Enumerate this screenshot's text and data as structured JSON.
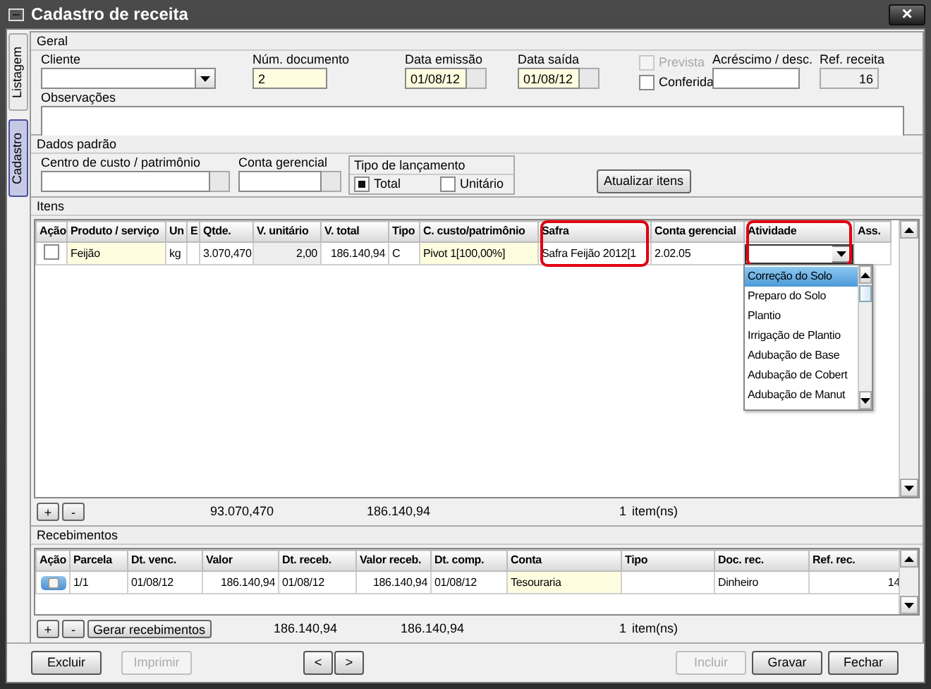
{
  "window": {
    "title": "Cadastro de receita",
    "close_glyph": "×"
  },
  "side_tabs": [
    {
      "label": "Listagem",
      "selected": false
    },
    {
      "label": "Cadastro",
      "selected": true
    }
  ],
  "geral": {
    "title": "Geral",
    "fields": [
      {
        "kind": "combo",
        "label": "Cliente"
      },
      {
        "kind": "text",
        "label": "Núm. documento",
        "value": "2",
        "required": true
      },
      {
        "kind": "date",
        "label": "Data emissão",
        "value": "01/08/12",
        "required": true
      },
      {
        "kind": "date",
        "label": "Data saída",
        "value": "01/08/12",
        "required": true
      },
      {
        "kind": "checks",
        "options": [
          {
            "label": "Prevista",
            "checked": false,
            "disabled": true
          },
          {
            "label": "Conferida",
            "checked": false,
            "disabled": false
          }
        ]
      },
      {
        "kind": "text",
        "label": "Acréscimo / desc.",
        "required": false
      },
      {
        "kind": "readonly",
        "label": "Ref. receita",
        "value": "16"
      }
    ],
    "notes": {
      "label": "Observações"
    }
  },
  "dados_padrao": {
    "title": "Dados padrão",
    "fields": [
      {
        "kind": "lookup",
        "label": "Centro de custo / patrimônio"
      },
      {
        "kind": "lookup",
        "label": "Conta gerencial"
      }
    ],
    "tipo_lancamento": {
      "label": "Tipo de lançamento",
      "options": [
        {
          "label": "Total",
          "selected": true
        },
        {
          "label": "Unitário",
          "selected": false
        }
      ]
    },
    "button": "Atualizar itens"
  },
  "itens": {
    "title": "Itens",
    "columns": [
      {
        "label": "Ação",
        "highlighted": false
      },
      {
        "label": "Produto / serviço",
        "highlighted": false
      },
      {
        "label": "Un",
        "highlighted": false
      },
      {
        "label": "E",
        "highlighted": false
      },
      {
        "label": "Qtde.",
        "highlighted": false
      },
      {
        "label": "V. unitário",
        "highlighted": false
      },
      {
        "label": "V. total",
        "highlighted": false
      },
      {
        "label": "Tipo",
        "highlighted": false
      },
      {
        "label": "C. custo/patrimônio",
        "highlighted": false
      },
      {
        "label": "Safra",
        "highlighted": true
      },
      {
        "label": "Conta gerencial",
        "highlighted": false
      },
      {
        "label": "Atividade",
        "highlighted": true
      },
      {
        "label": "Ass.",
        "highlighted": false
      }
    ],
    "rows": [
      {
        "cells": [
          {
            "kind": "checkbox",
            "checked": false
          },
          {
            "kind": "input",
            "text": "Feijão"
          },
          {
            "kind": "text",
            "text": "kg"
          },
          {
            "kind": "text"
          },
          {
            "kind": "text",
            "text": "3.070,470"
          },
          {
            "kind": "readonly",
            "text": "2,00"
          },
          {
            "kind": "text",
            "text": "186.140,94"
          },
          {
            "kind": "text",
            "text": "C"
          },
          {
            "kind": "input",
            "text": "Pivot 1[100,00%]"
          },
          {
            "kind": "text",
            "text": "Safra Feijão 2012[1"
          },
          {
            "kind": "text",
            "text": "2.02.05"
          },
          {
            "kind": "editor",
            "options": [
              {
                "label": "Correção do Solo",
                "selected": true
              },
              {
                "label": "Preparo do Solo",
                "selected": false
              },
              {
                "label": "Plantio",
                "selected": false
              },
              {
                "label": "Irrigação de Plantio",
                "selected": false
              },
              {
                "label": "Adubação de Base",
                "selected": false
              },
              {
                "label": "Adubação de Cobert",
                "selected": false
              },
              {
                "label": "Adubação de Manut",
                "selected": false
              }
            ]
          },
          {
            "kind": "text"
          }
        ]
      }
    ],
    "footer": {
      "buttons": [
        "+",
        "-"
      ],
      "totals": [
        "93.070,470",
        "186.140,94"
      ],
      "count": "1",
      "count_label": "item(ns)"
    }
  },
  "recebimentos": {
    "title": "Recebimentos",
    "columns": [
      {
        "label": "Ação"
      },
      {
        "label": "Parcela"
      },
      {
        "label": "Dt. venc."
      },
      {
        "label": "Valor"
      },
      {
        "label": "Dt. receb."
      },
      {
        "label": "Valor receb."
      },
      {
        "label": "Dt. comp."
      },
      {
        "label": "Conta"
      },
      {
        "label": "Tipo"
      },
      {
        "label": "Doc. rec."
      },
      {
        "label": "Ref. rec."
      }
    ],
    "rows": [
      {
        "cells": [
          {
            "kind": "toggle",
            "checked": false
          },
          {
            "kind": "text",
            "text": "1/1"
          },
          {
            "kind": "text",
            "text": "01/08/12"
          },
          {
            "kind": "text",
            "text": "186.140,94"
          },
          {
            "kind": "text",
            "text": "01/08/12"
          },
          {
            "kind": "text",
            "text": "186.140,94"
          },
          {
            "kind": "text",
            "text": "01/08/12"
          },
          {
            "kind": "input",
            "text": "Tesouraria"
          },
          {
            "kind": "text"
          },
          {
            "kind": "text",
            "text": "Dinheiro"
          },
          {
            "kind": "text",
            "text": "14"
          }
        ]
      }
    ],
    "footer": {
      "buttons": [
        "+",
        "-",
        "Gerar recebimentos"
      ],
      "totals": [
        "186.140,94",
        "186.140,94"
      ],
      "count": "1",
      "count_label": "item(ns)"
    }
  },
  "footer_buttons": {
    "left": [
      {
        "label": "Excluir",
        "disabled": false
      },
      {
        "label": "Imprimir",
        "disabled": true
      }
    ],
    "center": [
      {
        "label": "<",
        "disabled": false
      },
      {
        "label": ">",
        "disabled": false
      }
    ],
    "right": [
      {
        "label": "Incluir",
        "disabled": true
      },
      {
        "label": "Gravar",
        "disabled": false
      },
      {
        "label": "Fechar",
        "disabled": false
      }
    ]
  }
}
